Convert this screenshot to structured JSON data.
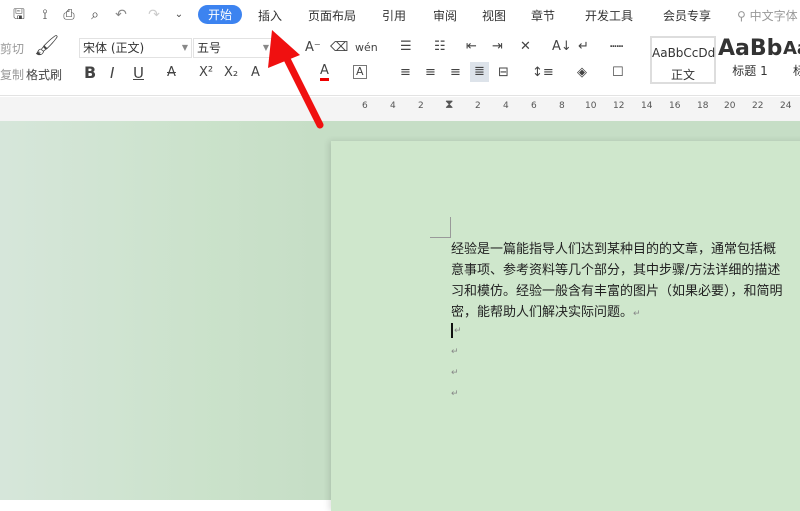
{
  "quick_access": {
    "icons": [
      "save-icon",
      "lasso-icon",
      "print-icon",
      "print-preview-icon",
      "undo-icon",
      "redo-icon",
      "customize-icon"
    ]
  },
  "tabs": [
    {
      "label": "开始",
      "active": true
    },
    {
      "label": "插入"
    },
    {
      "label": "页面布局"
    },
    {
      "label": "引用"
    },
    {
      "label": "审阅"
    },
    {
      "label": "视图"
    },
    {
      "label": "章节"
    },
    {
      "label": "开发工具"
    },
    {
      "label": "会员专享"
    }
  ],
  "search": {
    "placeholder": "中文字体"
  },
  "ribbon": {
    "cut": "剪切",
    "copy": "复制",
    "format_painter": "格式刷",
    "font_name": "宋体 (正文)",
    "font_size": "五号",
    "styles": [
      {
        "preview": "AaBbCcDd",
        "label": "正文"
      },
      {
        "preview": "AaBb",
        "label": "标题 1"
      },
      {
        "preview": "Aa",
        "label": "标"
      }
    ]
  },
  "ruler": {
    "left": [
      "6",
      "4",
      "2"
    ],
    "right": [
      "2",
      "4",
      "6",
      "8",
      "10",
      "12",
      "14",
      "16",
      "18",
      "20",
      "22",
      "24"
    ]
  },
  "document": {
    "lines": [
      "经验是一篇能指导人们达到某种目的的文章，通常包括概",
      "意事项、参考资料等几个部分，其中步骤/方法详细的描述",
      "习和模仿。经验一般含有丰富的图片（如果必要），和简明",
      "密，能帮助人们解决实际问题。"
    ],
    "paragraph_mark": "↵"
  },
  "colors": {
    "accent": "#3c83f0",
    "page": "#cfe7cc",
    "arrow": "#f01010"
  }
}
